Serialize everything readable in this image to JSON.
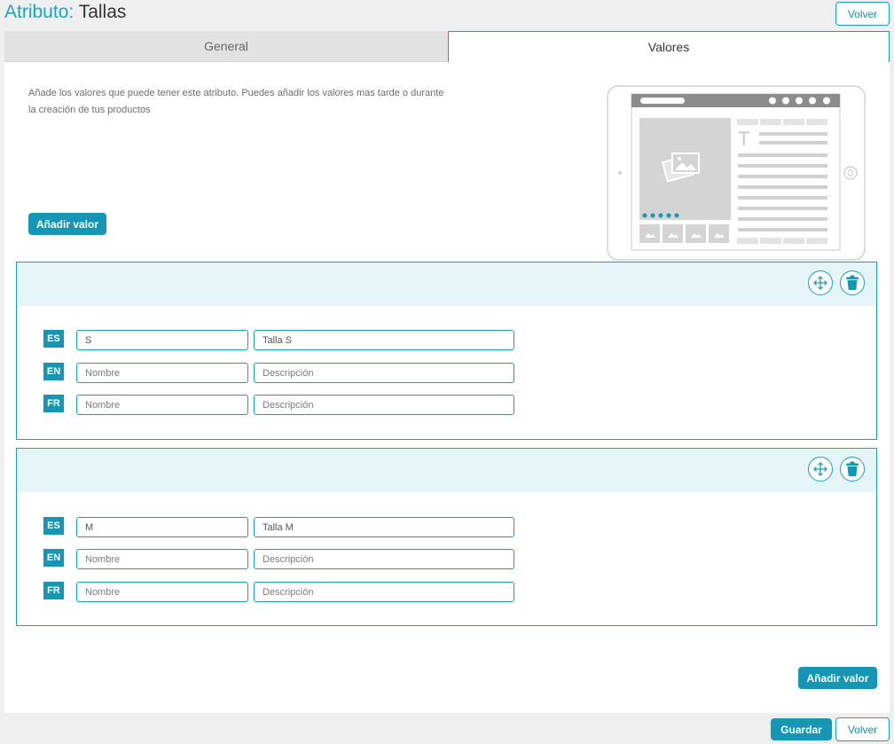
{
  "header": {
    "title_prefix": "Atributo:",
    "title_name": "Tallas",
    "back_label": "Volver"
  },
  "tabs": [
    {
      "label": "General",
      "active": false
    },
    {
      "label": "Valores",
      "active": true
    }
  ],
  "intro": {
    "text": "Añade los valores que puede tener este atributo. Puedes añadir los valores mas tarde o durante la creación de tus productos",
    "add_value_label": "Añadir valor"
  },
  "values": [
    {
      "rows": [
        {
          "lang": "ES",
          "name": "S",
          "name_placeholder": "Nombre",
          "description": "Talla S",
          "description_placeholder": "Descripción"
        },
        {
          "lang": "EN",
          "name": "",
          "name_placeholder": "Nombre",
          "description": "",
          "description_placeholder": "Descripción"
        },
        {
          "lang": "FR",
          "name": "",
          "name_placeholder": "Nombre",
          "description": "",
          "description_placeholder": "Descripción"
        }
      ]
    },
    {
      "rows": [
        {
          "lang": "ES",
          "name": "M",
          "name_placeholder": "Nombre",
          "description": "Talla M",
          "description_placeholder": "Descripción"
        },
        {
          "lang": "EN",
          "name": "",
          "name_placeholder": "Nombre",
          "description": "",
          "description_placeholder": "Descripción"
        },
        {
          "lang": "FR",
          "name": "",
          "name_placeholder": "Nombre",
          "description": "",
          "description_placeholder": "Descripción"
        }
      ]
    }
  ],
  "footer": {
    "add_value_label": "Añadir valor",
    "save_label": "Guardar",
    "back_label": "Volver"
  },
  "icons": {
    "move": "move-arrows-icon",
    "delete": "trash-icon",
    "illustration": "tablet-product-preview"
  },
  "colors": {
    "accent": "#1596b4",
    "border": "#1a9fb8",
    "card_header": "#e5f4f7",
    "background": "#efefef"
  }
}
